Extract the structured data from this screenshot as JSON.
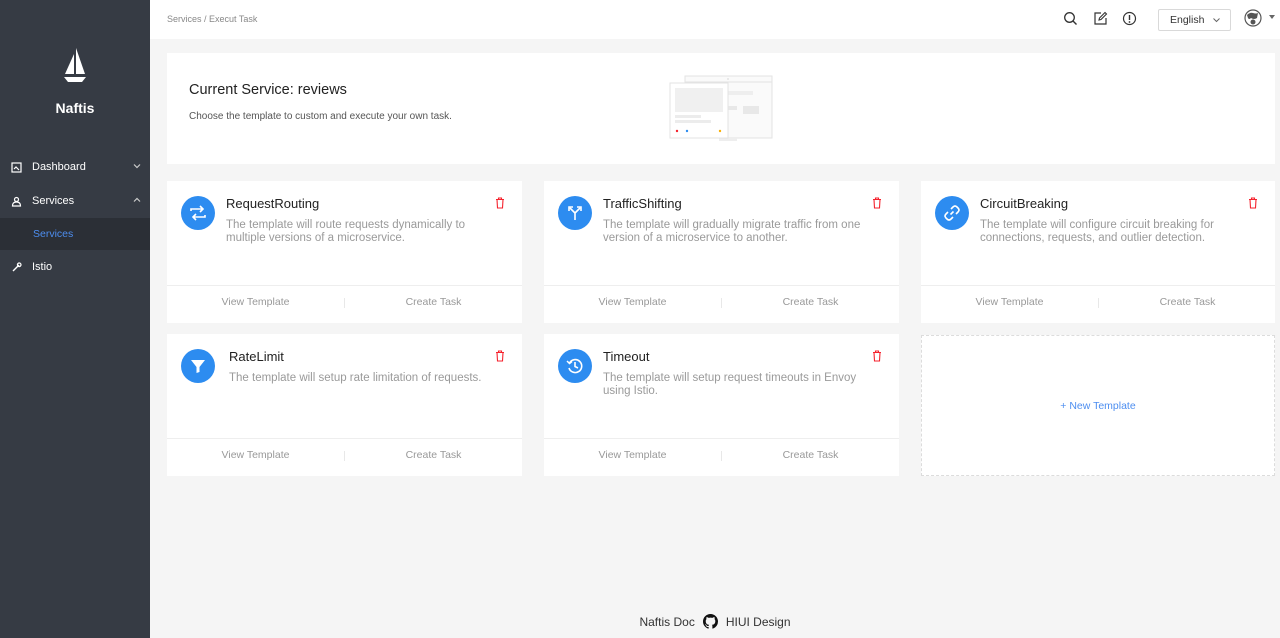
{
  "app": {
    "name": "Naftis"
  },
  "sidebar": {
    "items": [
      {
        "label": "Dashboard",
        "icon": "dashboard-icon",
        "chevron": "down"
      },
      {
        "label": "Services",
        "icon": "services-icon",
        "chevron": "up"
      },
      {
        "label": "Istio",
        "icon": "istio-icon"
      }
    ],
    "subitem": {
      "label": "Services"
    }
  },
  "header": {
    "breadcrumb": "Services / Execut Task",
    "icons": [
      "search-icon",
      "edit-icon",
      "info-icon"
    ],
    "language": "English"
  },
  "banner": {
    "title": "Current Service: reviews",
    "description": "Choose the template to custom and execute your own task."
  },
  "cards": [
    {
      "title": "RequestRouting",
      "icon": "swap-icon",
      "description": "The template will route requests dynamically to multiple versions of a microservice.",
      "view_label": "View Template",
      "create_label": "Create Task"
    },
    {
      "title": "TrafficShifting",
      "icon": "fork-icon",
      "description": "The template will gradually migrate traffic from one version of a microservice to another.",
      "view_label": "View Template",
      "create_label": "Create Task"
    },
    {
      "title": "CircuitBreaking",
      "icon": "link-icon",
      "description": "The template will configure circuit breaking for connections, requests, and outlier detection.",
      "view_label": "View Template",
      "create_label": "Create Task"
    },
    {
      "title": "RateLimit",
      "icon": "filter-icon",
      "description": "The template will setup rate limitation of requests.",
      "view_label": "View Template",
      "create_label": "Create Task"
    },
    {
      "title": "Timeout",
      "icon": "history-icon",
      "description": "The template will setup request timeouts in Envoy using Istio.",
      "view_label": "View Template",
      "create_label": "Create Task"
    }
  ],
  "new_template_label": "+ New Template",
  "footer": {
    "doc_label": "Naftis Doc",
    "design_label": "HIUI Design"
  },
  "colors": {
    "sidebar_bg": "#363b44",
    "accent": "#2d8cf0",
    "delete": "#f5222d"
  }
}
